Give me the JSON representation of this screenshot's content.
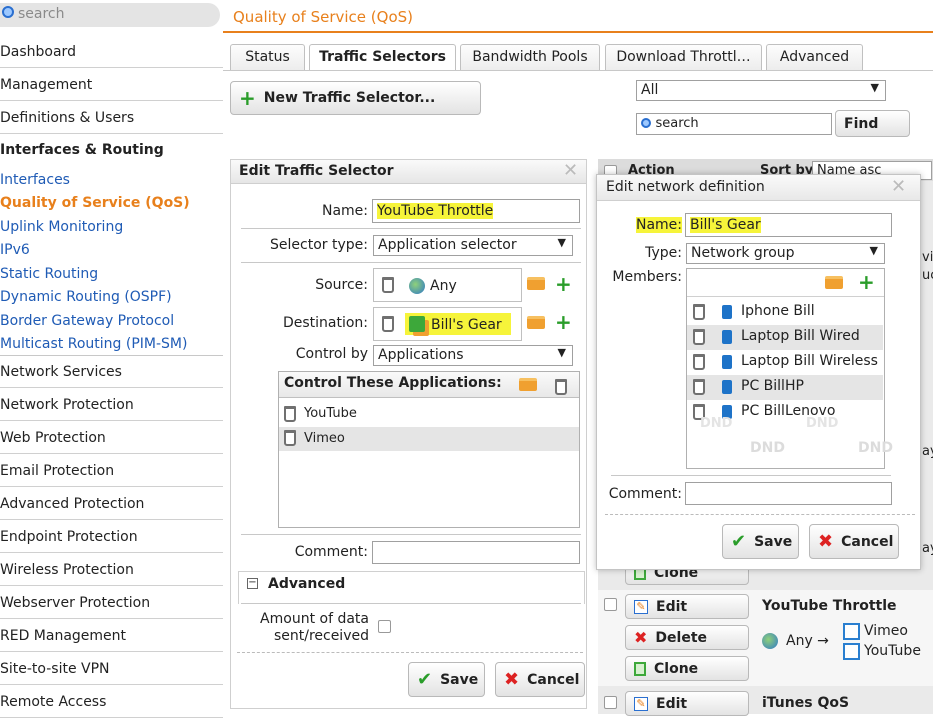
{
  "search": {
    "placeholder": "search"
  },
  "page_title": "Quality of Service (QoS)",
  "sidebar": {
    "dashboard": "Dashboard",
    "management": "Management",
    "definitions": "Definitions & Users",
    "interfaces_routing": "Interfaces & Routing",
    "sub": [
      "Interfaces",
      "Quality of Service (QoS)",
      "Uplink Monitoring",
      "IPv6",
      "Static Routing",
      "Dynamic Routing (OSPF)",
      "Border Gateway Protocol",
      "Multicast Routing (PIM-SM)"
    ],
    "sections": [
      "Network Services",
      "Network Protection",
      "Web Protection",
      "Email Protection",
      "Advanced Protection",
      "Endpoint Protection",
      "Wireless Protection",
      "Webserver Protection",
      "RED Management",
      "Site-to-site VPN",
      "Remote Access"
    ]
  },
  "tabs": [
    "Status",
    "Traffic Selectors",
    "Bandwidth Pools",
    "Download Throttl…",
    "Advanced"
  ],
  "toolbar": {
    "new_selector": "New Traffic Selector...",
    "filter_value": "All",
    "search_placeholder": "search",
    "find": "Find"
  },
  "edit_selector": {
    "title": "Edit Traffic Selector",
    "name_label": "Name:",
    "name_value": "YouTube Throttle",
    "type_label": "Selector type:",
    "type_value": "Application selector",
    "source_label": "Source:",
    "source_value": "Any",
    "dest_label": "Destination:",
    "dest_value": "Bill's Gear",
    "control_label": "Control by",
    "control_value": "Applications",
    "apps_title": "Control These Applications:",
    "apps": [
      "YouTube",
      "Vimeo"
    ],
    "comment_label": "Comment:",
    "advanced_title": "Advanced",
    "amount_label_1": "Amount of data",
    "amount_label_2": "sent/received",
    "save": "Save",
    "cancel": "Cancel"
  },
  "list_header": {
    "action": "Action",
    "sort_by": "Sort by:",
    "sort_value": "Name asc"
  },
  "netdef": {
    "title": "Edit network definition",
    "name_label": "Name:",
    "name_value": "Bill's Gear",
    "type_label": "Type:",
    "type_value": "Network group",
    "members_label": "Members:",
    "members": [
      "Iphone Bill",
      "Laptop Bill Wired",
      "Laptop Bill Wireless",
      "PC BillHP",
      "PC BillLenovo"
    ],
    "dnd": "DND",
    "comment_label": "Comment:",
    "save": "Save",
    "cancel": "Cancel"
  },
  "rows": [
    {
      "clone": "Clone"
    },
    {
      "edit": "Edit",
      "delete": "Delete",
      "clone": "Clone",
      "name": "YouTube Throttle",
      "source": "Any →",
      "apps": [
        "Vimeo",
        "YouTube"
      ]
    },
    {
      "edit": "Edit",
      "name": "iTunes QoS"
    }
  ],
  "peek": {
    "a": "vid",
    "b": "uc",
    "c": "ay",
    "d": "ay"
  },
  "colors": {
    "accent": "#e8801c",
    "link": "#1f5bb5",
    "highlight": "#f6f43a"
  }
}
